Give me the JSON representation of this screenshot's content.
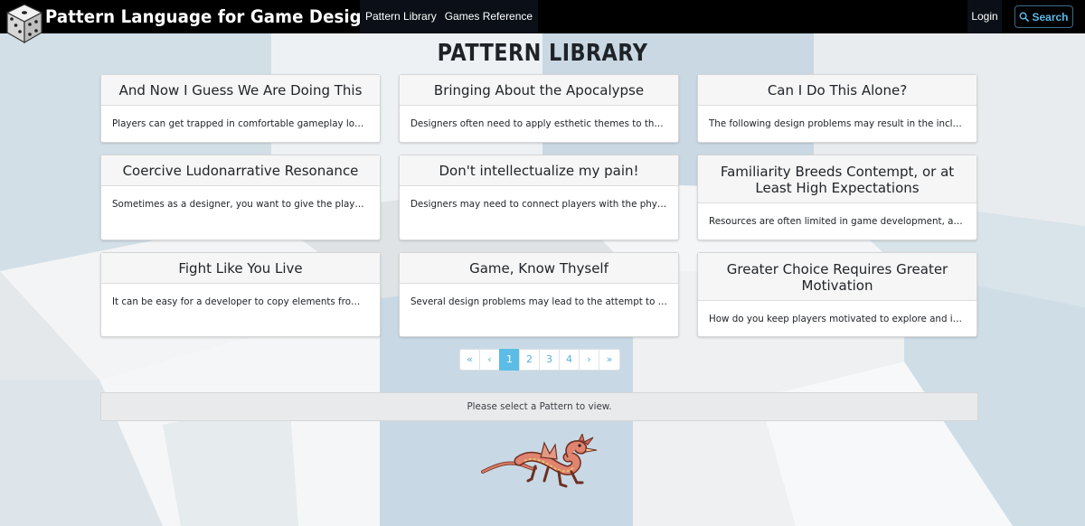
{
  "navbar": {
    "brand_title": "Pattern Language for Game Design",
    "links": [
      "Pattern Library",
      "Games Reference"
    ],
    "login_label": "Login",
    "search_label": "Search"
  },
  "page_title": "PATTERN LIBRARY",
  "cards": [
    {
      "title": "And Now I Guess We Are Doing This",
      "excerpt": "Players can get trapped in comfortable gameplay loops, ..."
    },
    {
      "title": "Bringing About the Apocalypse",
      "excerpt": "Designers often need to apply esthetic themes to the ga..."
    },
    {
      "title": "Can I Do This Alone?",
      "excerpt": "The following design problems may result in the inclusion..."
    },
    {
      "title": "Coercive Ludonarrative Resonance",
      "excerpt": "Sometimes as a designer, you want to give the player a s..."
    },
    {
      "title": "Don't intellectualize my pain!",
      "excerpt": "Designers may need to connect players with the physical..."
    },
    {
      "title": "Familiarity Breeds Contempt, or at Least High Expectations",
      "excerpt": "Resources are often limited in game development, and th..."
    },
    {
      "title": "Fight Like You Live",
      "excerpt": "It can be easy for a developer to copy elements from oth..."
    },
    {
      "title": "Game, Know Thyself",
      "excerpt": "Several design problems may lead to the attempt to add ..."
    },
    {
      "title": "Greater Choice Requires Greater Motivation",
      "excerpt": "How do you keep players motivated to explore and intera..."
    }
  ],
  "pagination": {
    "first": "«",
    "prev": "‹",
    "pages": [
      "1",
      "2",
      "3",
      "4"
    ],
    "active_page": "1",
    "next": "›",
    "last": "»"
  },
  "status_message": "Please select a Pattern to view.",
  "colors": {
    "navbar_bg": "#000000",
    "accent": "#5bbde6",
    "link": "#4fb2df"
  },
  "icons": [
    "dice-logo-icon",
    "search-icon",
    "dragon-illustration"
  ]
}
